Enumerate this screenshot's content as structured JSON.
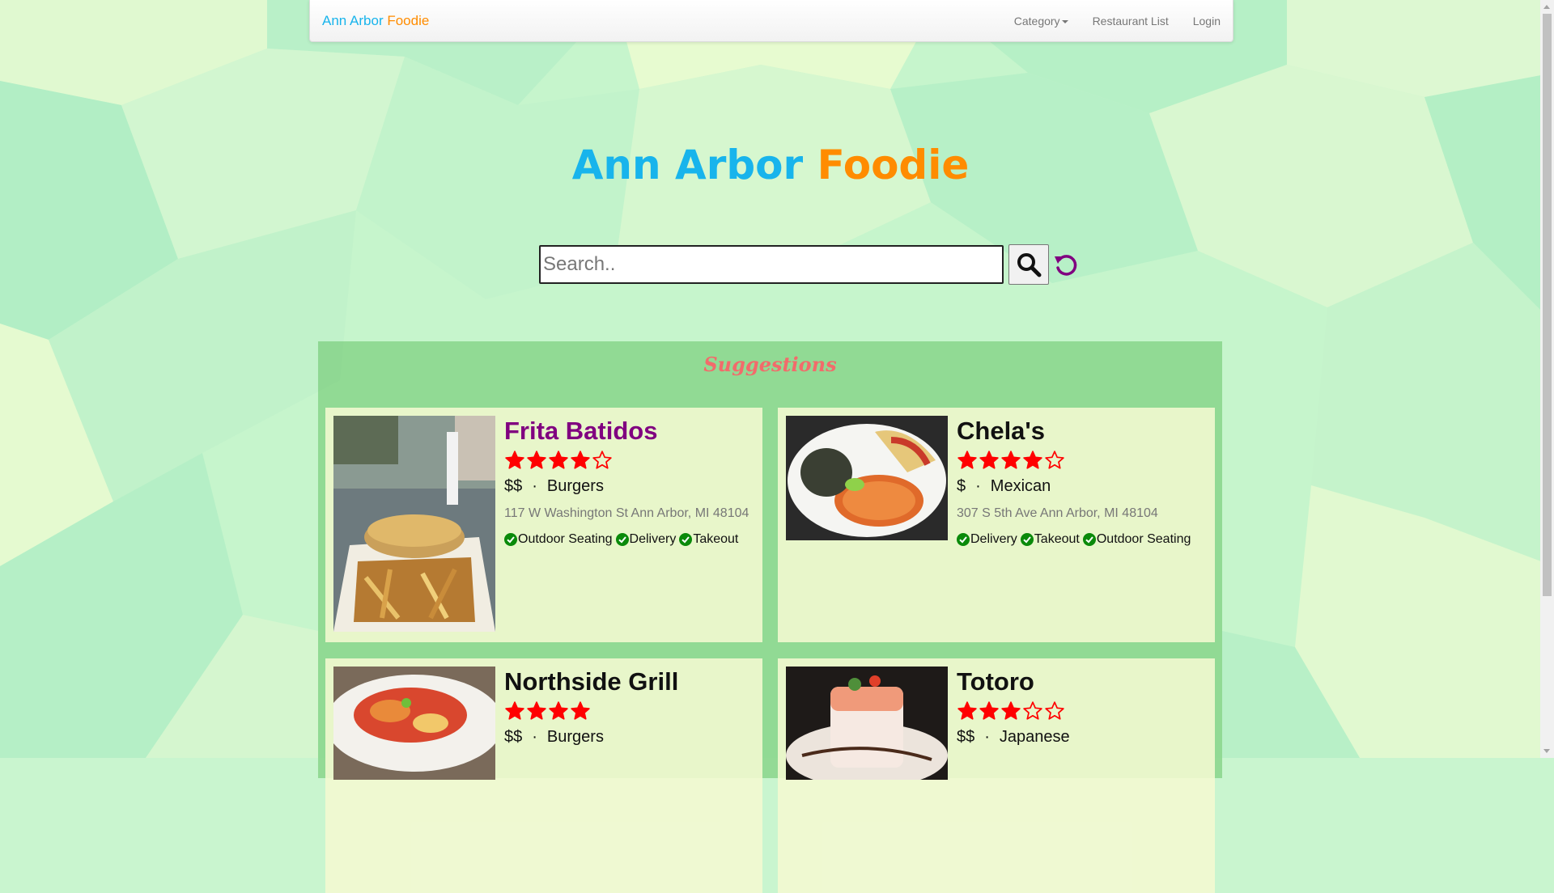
{
  "brand": {
    "part1": "Ann Arbor",
    "part2": "Foodie"
  },
  "nav": {
    "category": "Category",
    "restaurant_list": "Restaurant List",
    "login": "Login"
  },
  "hero": {
    "title_part1": "Ann Arbor",
    "title_part2": "Foodie"
  },
  "search": {
    "placeholder": "Search..",
    "value": ""
  },
  "suggestions": {
    "title": "Suggestions",
    "cards": [
      {
        "name": "Frita Batidos",
        "rating": 4,
        "price": "$$",
        "category": "Burgers",
        "address": "117 W Washington St Ann Arbor, MI 48104",
        "features": [
          "Outdoor Seating",
          "Delivery",
          "Takeout"
        ]
      },
      {
        "name": "Chela's",
        "rating": 4,
        "price": "$",
        "category": "Mexican",
        "address": "307 S 5th Ave Ann Arbor, MI 48104",
        "features": [
          "Delivery",
          "Takeout",
          "Outdoor Seating"
        ]
      },
      {
        "name": "Northside Grill",
        "rating": 4,
        "price": "$$",
        "category": "Burgers"
      },
      {
        "name": "Totoro",
        "rating": 3,
        "price": "$$",
        "category": "Japanese"
      }
    ]
  },
  "separator_dot": "·",
  "colors": {
    "brand_blue": "#18b4ec",
    "brand_orange": "#ff8c00",
    "star_red": "#ff0000",
    "check_green": "#0a8a0a",
    "reset_purple": "#800080",
    "suggestions_title": "#f26b6b"
  }
}
